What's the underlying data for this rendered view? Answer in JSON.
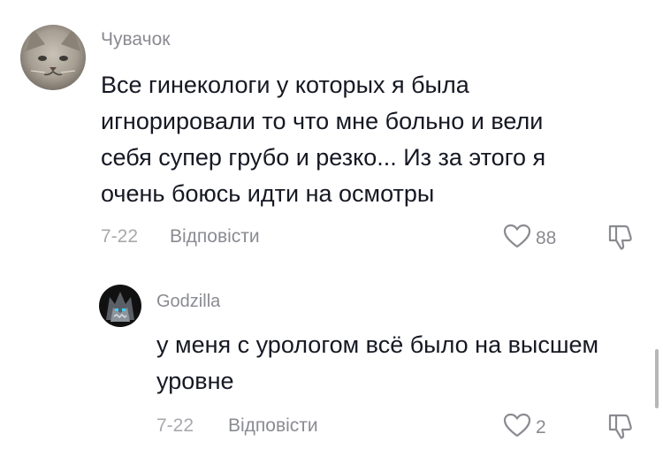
{
  "comments": [
    {
      "username": "Чувачок",
      "lines": [
        "Все гинекологи у которых я была",
        "игнорировали то что мне больно и вели",
        "себя супер грубо и резко... Из за этого я",
        "очень боюсь идти на осмотры"
      ],
      "date": "7-22",
      "reply_label": "Відповісти",
      "likes": "88"
    }
  ],
  "replies": [
    {
      "username": "Godzilla",
      "lines": [
        "у меня с урологом всё было на высшем",
        "уровне"
      ],
      "date": "7-22",
      "reply_label": "Відповісти",
      "likes": "2"
    }
  ],
  "icons": {
    "like": "heart-outline-icon",
    "dislike": "thumbs-down-icon"
  },
  "colors": {
    "text": "#161823",
    "username": "#8a8b91",
    "meta": "#a8a9ad"
  }
}
